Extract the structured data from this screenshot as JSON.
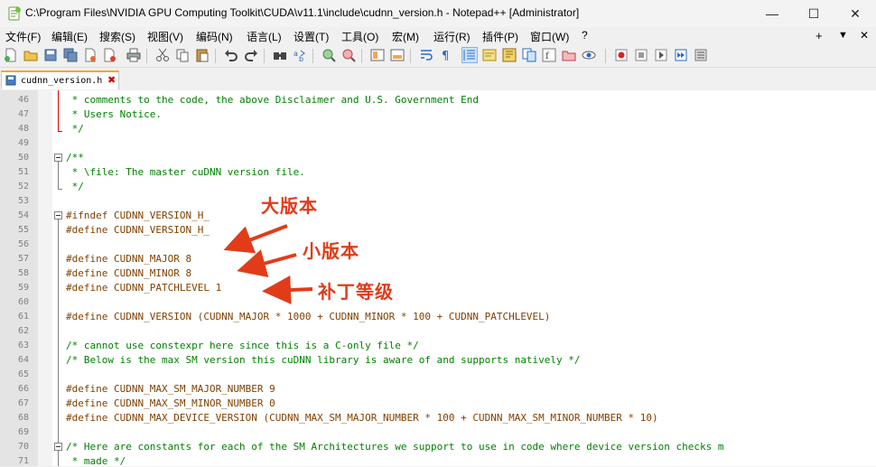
{
  "window": {
    "title": "C:\\Program Files\\NVIDIA GPU Computing Toolkit\\CUDA\\v11.1\\include\\cudnn_version.h - Notepad++ [Administrator]",
    "minimize": "—",
    "maximize": "☐",
    "close": "✕"
  },
  "menu": [
    "文件(F)",
    "编辑(E)",
    "搜索(S)",
    "视图(V)",
    "编码(N)",
    "语言(L)",
    "设置(T)",
    "工具(O)",
    "宏(M)",
    "运行(R)",
    "插件(P)",
    "窗口(W)",
    "?"
  ],
  "menu_right": {
    "plus": "+",
    "dropdown": "▼",
    "close": "✕"
  },
  "tab": {
    "filename": "cudnn_version.h",
    "close": "✖"
  },
  "lines": [
    {
      "n": "46",
      "text": " * comments to the code, the above Disclaimer and U.S. Government End",
      "cls": "cmt"
    },
    {
      "n": "47",
      "text": " * Users Notice.",
      "cls": "cmt"
    },
    {
      "n": "48",
      "text": " */",
      "cls": "cmt"
    },
    {
      "n": "49",
      "text": "",
      "cls": ""
    },
    {
      "n": "50",
      "text": "/**",
      "cls": "cmt"
    },
    {
      "n": "51",
      "text": " * \\file: The master cuDNN version file.",
      "cls": "cmt"
    },
    {
      "n": "52",
      "text": " */",
      "cls": "cmt"
    },
    {
      "n": "53",
      "text": "",
      "cls": ""
    },
    {
      "n": "54",
      "text": "#ifndef CUDNN_VERSION_H_",
      "cls": "pre"
    },
    {
      "n": "55",
      "text": "#define CUDNN_VERSION_H_",
      "cls": "pre"
    },
    {
      "n": "56",
      "text": "",
      "cls": ""
    },
    {
      "n": "57",
      "text": "#define CUDNN_MAJOR 8",
      "cls": "pre"
    },
    {
      "n": "58",
      "text": "#define CUDNN_MINOR 8",
      "cls": "pre"
    },
    {
      "n": "59",
      "text": "#define CUDNN_PATCHLEVEL 1",
      "cls": "pre"
    },
    {
      "n": "60",
      "text": "",
      "cls": ""
    },
    {
      "n": "61",
      "text": "#define CUDNN_VERSION (CUDNN_MAJOR * 1000 + CUDNN_MINOR * 100 + CUDNN_PATCHLEVEL)",
      "cls": "pre"
    },
    {
      "n": "62",
      "text": "",
      "cls": ""
    },
    {
      "n": "63",
      "text": "/* cannot use constexpr here since this is a C-only file */",
      "cls": "cmt"
    },
    {
      "n": "64",
      "text": "/* Below is the max SM version this cuDNN library is aware of and supports natively */",
      "cls": "cmt"
    },
    {
      "n": "65",
      "text": "",
      "cls": ""
    },
    {
      "n": "66",
      "text": "#define CUDNN_MAX_SM_MAJOR_NUMBER 9",
      "cls": "pre"
    },
    {
      "n": "67",
      "text": "#define CUDNN_MAX_SM_MINOR_NUMBER 0",
      "cls": "pre"
    },
    {
      "n": "68",
      "text": "#define CUDNN_MAX_DEVICE_VERSION (CUDNN_MAX_SM_MAJOR_NUMBER * 100 + CUDNN_MAX_SM_MINOR_NUMBER * 10)",
      "cls": "pre"
    },
    {
      "n": "69",
      "text": "",
      "cls": ""
    },
    {
      "n": "70",
      "text": "/* Here are constants for each of the SM Architectures we support to use in code where device version checks m",
      "cls": "cmt"
    },
    {
      "n": "71",
      "text": " * made */",
      "cls": "cmt"
    }
  ],
  "annotations": {
    "major": "大版本",
    "minor": "小版本",
    "patch": "补丁等级",
    "arrow_color": "#e23b1a"
  },
  "colors": {
    "comment": "#008000",
    "preprocessor": "#804000",
    "tab_accent": "#f8a52a"
  }
}
